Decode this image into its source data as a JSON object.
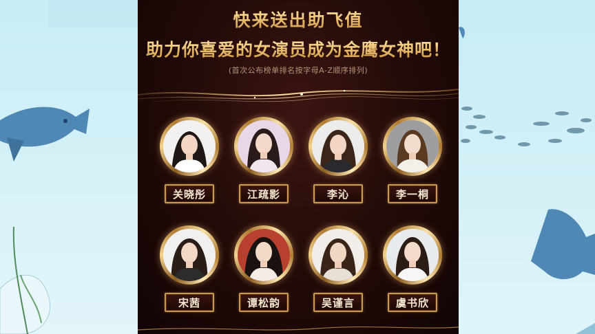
{
  "poster": {
    "headline_line1": "快来送出助飞值",
    "headline_line2": "助力你喜爱的女演员成为金鹰女神吧！",
    "note": "(首次公布榜单排名按字母A-Z顺序排列)"
  },
  "colors": {
    "poster_bg": "#200a08",
    "gold": "#e3b364",
    "side_bg": "#cfeef6",
    "fish": "#4f87b5"
  },
  "actresses": [
    {
      "name": "关晓彤",
      "bg": "#f3f1ef",
      "hair": "#1f1714",
      "top": "#ffffff"
    },
    {
      "name": "江疏影",
      "bg": "#e9d6e6",
      "hair": "#2a1a1a",
      "top": "#f2e6ee"
    },
    {
      "name": "李沁",
      "bg": "#ececea",
      "hair": "#3a2518",
      "top": "#2a2a2e"
    },
    {
      "name": "李一桐",
      "bg": "#9e9ea0",
      "hair": "#5a3b22",
      "top": "#f3efe9"
    },
    {
      "name": "宋茜",
      "bg": "#f2f0ee",
      "hair": "#2a1c16",
      "top": "#2c2c2c"
    },
    {
      "name": "谭松韵",
      "bg": "#b8402f",
      "hair": "#1a1210",
      "top": "#f4ece6"
    },
    {
      "name": "吴谨言",
      "bg": "#f1ede9",
      "hair": "#3a2418",
      "top": "#e8dfd6"
    },
    {
      "name": "虞书欣",
      "bg": "#e7ebee",
      "hair": "#2b1c16",
      "top": "#f6f6f6"
    }
  ]
}
